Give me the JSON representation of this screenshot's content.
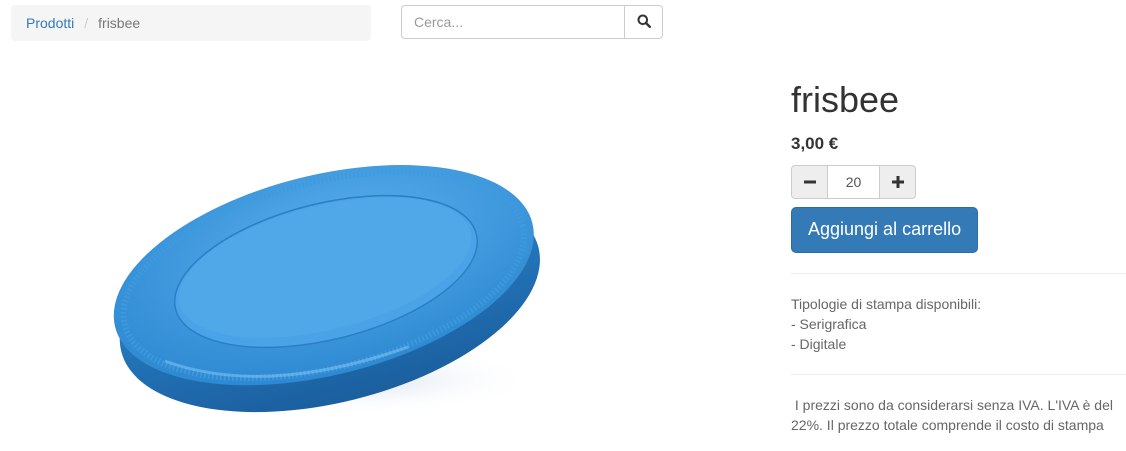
{
  "breadcrumb": {
    "parent": "Prodotti",
    "separator": "/",
    "current": "frisbee"
  },
  "search": {
    "placeholder": "Cerca...",
    "value": "",
    "icon": "search-icon"
  },
  "product": {
    "title": "frisbee",
    "price": "3,00 €",
    "quantity": "20",
    "minus_icon": "minus-icon",
    "plus_icon": "plus-icon",
    "add_to_cart_label": "Aggiungi al carrello",
    "print_types_heading": "Tipologie di stampa disponibili:",
    "print_types": [
      "- Serigrafica",
      "- Digitale"
    ],
    "tax_note": " I prezzi sono da considerarsi senza IVA. L'IVA è del 22%. Il prezzo totale comprende il costo di stampa"
  },
  "colors": {
    "primary": "#337ab7",
    "frisbee": "#2f8fd6"
  }
}
